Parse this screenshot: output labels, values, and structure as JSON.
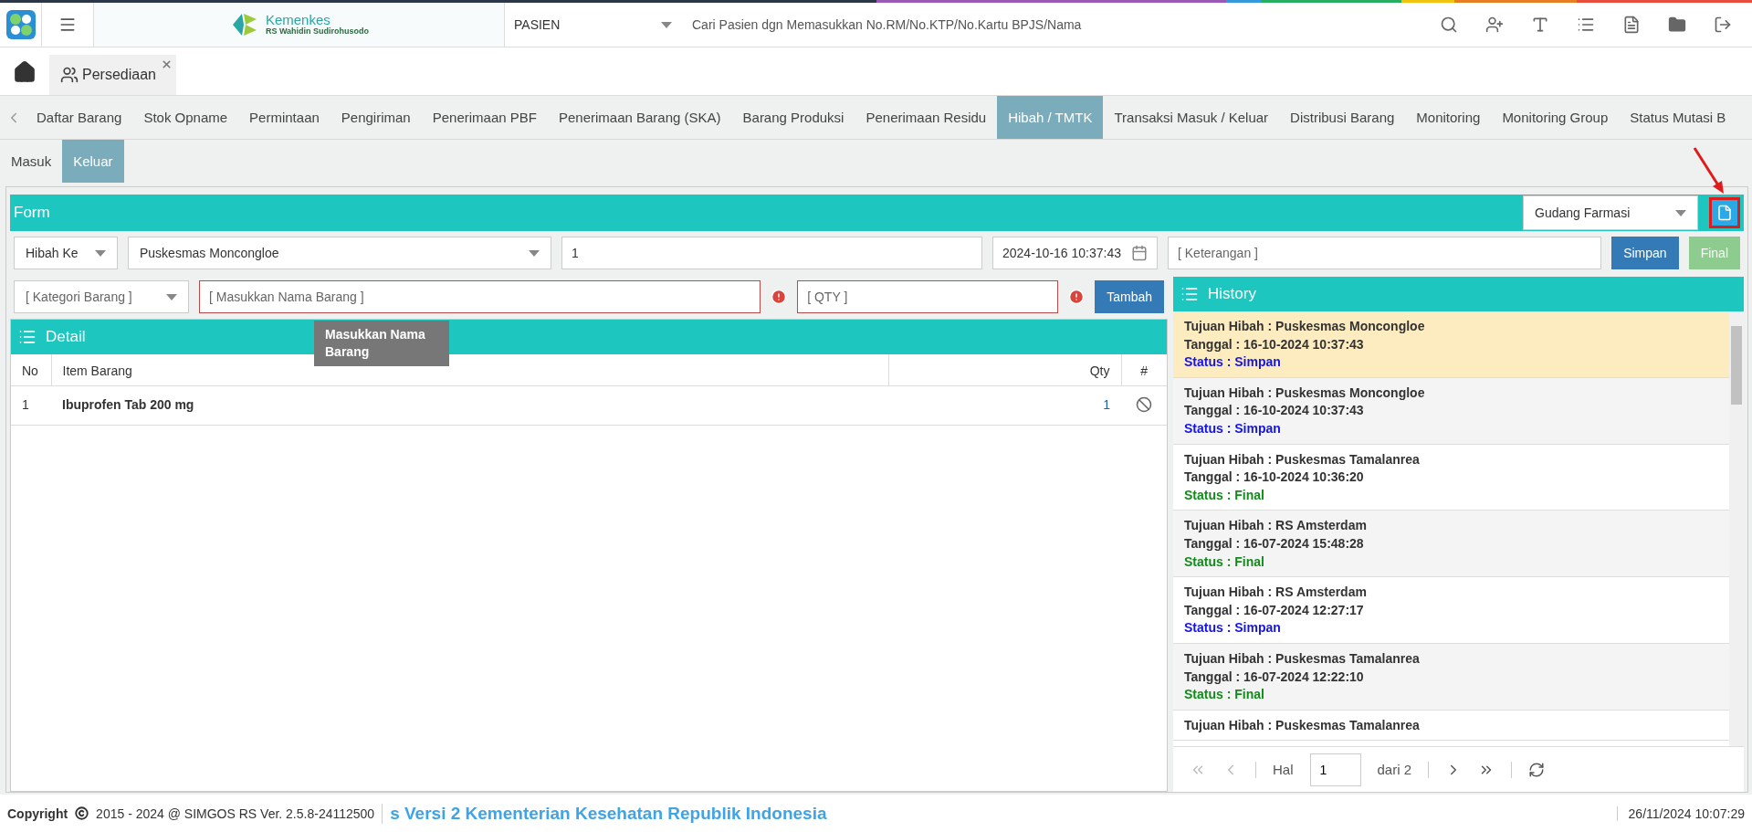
{
  "topbar": {
    "brand_name": "Kemenkes",
    "brand_sub": "RS Wahidin Sudirohusodo",
    "patient_type": "PASIEN",
    "search_placeholder": "Cari Pasien dgn Memasukkan No.RM/No.KTP/No.Kartu BPJS/Nama"
  },
  "page_tabs": [
    {
      "label": "Persediaan",
      "selected": true
    }
  ],
  "nav_tabs": [
    {
      "label": "Daftar Barang",
      "selected": false
    },
    {
      "label": "Stok Opname",
      "selected": false
    },
    {
      "label": "Permintaan",
      "selected": false
    },
    {
      "label": "Pengiriman",
      "selected": false
    },
    {
      "label": "Penerimaan PBF",
      "selected": false
    },
    {
      "label": "Penerimaan Barang (SKA)",
      "selected": false
    },
    {
      "label": "Barang Produksi",
      "selected": false
    },
    {
      "label": "Penerimaan Residu",
      "selected": false
    },
    {
      "label": "Hibah / TMTK",
      "selected": true
    },
    {
      "label": "Transaksi Masuk / Keluar",
      "selected": false
    },
    {
      "label": "Distribusi Barang",
      "selected": false
    },
    {
      "label": "Monitoring",
      "selected": false
    },
    {
      "label": "Monitoring Group",
      "selected": false
    },
    {
      "label": "Status Mutasi B",
      "selected": false
    }
  ],
  "sub_tabs": [
    {
      "label": "Masuk",
      "selected": false
    },
    {
      "label": "Keluar",
      "selected": true
    }
  ],
  "form": {
    "title": "Form",
    "warehouse": "Gudang Farmasi",
    "type": "Hibah Ke",
    "destination": "Puskesmas Moncongloe",
    "number": "1",
    "date": "2024-10-16 10:37:43",
    "note_placeholder": "[ Keterangan ]",
    "save_button": "Simpan",
    "final_button": {
      "label": "Final",
      "disabled": true
    }
  },
  "item_entry": {
    "category_placeholder": "[ Kategori Barang ]",
    "name_placeholder": "[ Masukkan Nama Barang ]",
    "name_invalid": true,
    "qty_placeholder": "[ QTY ]",
    "qty_invalid": true,
    "add_button": "Tambah",
    "tooltip": "Masukkan Nama Barang"
  },
  "detail": {
    "title": "Detail",
    "columns": [
      "No",
      "Item Barang",
      "Qty",
      "#"
    ],
    "rows": [
      {
        "no": "1",
        "item": "Ibuprofen Tab 200 mg",
        "qty": "1"
      }
    ]
  },
  "history": {
    "title": "History",
    "items": [
      {
        "destination": "Tujuan Hibah : Puskesmas Moncongloe",
        "date": "Tanggal : 16-10-2024 10:37:43",
        "status": "Status : Simpan",
        "kind": "simpan",
        "selected": true
      },
      {
        "destination": "Tujuan Hibah : Puskesmas Moncongloe",
        "date": "Tanggal : 16-10-2024 10:37:43",
        "status": "Status : Simpan",
        "kind": "simpan",
        "selected": false
      },
      {
        "destination": "Tujuan Hibah : Puskesmas Tamalanrea",
        "date": "Tanggal : 16-10-2024 10:36:20",
        "status": "Status : Final",
        "kind": "final",
        "selected": false
      },
      {
        "destination": "Tujuan Hibah : RS Amsterdam",
        "date": "Tanggal : 16-07-2024 15:48:28",
        "status": "Status : Final",
        "kind": "final",
        "selected": false
      },
      {
        "destination": "Tujuan Hibah : RS Amsterdam",
        "date": "Tanggal : 16-07-2024 12:27:17",
        "status": "Status : Simpan",
        "kind": "simpan",
        "selected": false
      },
      {
        "destination": "Tujuan Hibah : Puskesmas Tamalanrea",
        "date": "Tanggal : 16-07-2024 12:22:10",
        "status": "Status : Final",
        "kind": "final",
        "selected": false
      },
      {
        "destination": "Tujuan Hibah : Puskesmas Tamalanrea",
        "selected": false
      }
    ],
    "pager": {
      "page_label": "Hal",
      "page": "1",
      "total": "dari 2"
    }
  },
  "footer": {
    "copyright_label": "Copyright",
    "copyright_text": "2015 - 2024 @ SIMGOS RS Ver. 2.5.8-24112500",
    "marquee": "s Versi 2 Kementerian Kesehatan Republik Indonesia",
    "datetime": "26/11/2024 10:07:29"
  }
}
